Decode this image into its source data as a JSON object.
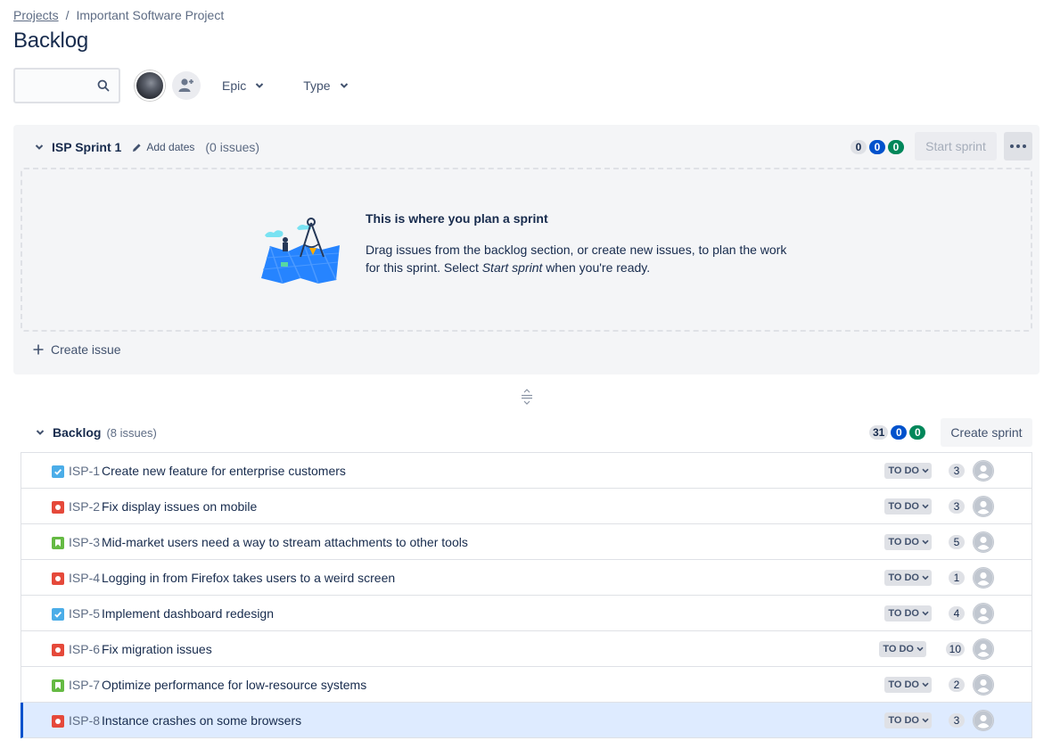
{
  "breadcrumb": {
    "projects": "Projects",
    "separator": "/",
    "project": "Important Software Project"
  },
  "page_title": "Backlog",
  "toolbar": {
    "search_placeholder": "",
    "filters": [
      {
        "label": "Epic"
      },
      {
        "label": "Type"
      }
    ]
  },
  "sprint": {
    "name": "ISP Sprint 1",
    "add_dates": "Add dates",
    "issue_count": "(0 issues)",
    "counts": {
      "todo": "0",
      "in_progress": "0",
      "done": "0"
    },
    "start_label": "Start sprint",
    "empty_title": "This is where you plan a sprint",
    "empty_desc_1": "Drag issues from the backlog section, or create new issues, to plan the work for this sprint. Select ",
    "empty_desc_em": "Start sprint",
    "empty_desc_2": " when you're ready.",
    "create_issue": "Create issue"
  },
  "backlog": {
    "title": "Backlog",
    "issue_count": "(8 issues)",
    "counts": {
      "todo": "31",
      "in_progress": "0",
      "done": "0"
    },
    "create_sprint": "Create sprint",
    "issues": [
      {
        "type": "task",
        "key": "ISP-1",
        "summary": "Create new feature for enterprise customers",
        "status": "TO DO",
        "estimate": "3"
      },
      {
        "type": "bug",
        "key": "ISP-2",
        "summary": "Fix display issues on mobile",
        "status": "TO DO",
        "estimate": "3"
      },
      {
        "type": "story",
        "key": "ISP-3",
        "summary": "Mid-market users need a way to stream attachments to other tools",
        "status": "TO DO",
        "estimate": "5"
      },
      {
        "type": "bug",
        "key": "ISP-4",
        "summary": "Logging in from Firefox takes users to a weird screen",
        "status": "TO DO",
        "estimate": "1"
      },
      {
        "type": "task",
        "key": "ISP-5",
        "summary": "Implement dashboard redesign",
        "status": "TO DO",
        "estimate": "4"
      },
      {
        "type": "bug",
        "key": "ISP-6",
        "summary": "Fix migration issues",
        "status": "TO DO",
        "estimate": "10"
      },
      {
        "type": "story",
        "key": "ISP-7",
        "summary": "Optimize performance for low-resource systems",
        "status": "TO DO",
        "estimate": "2"
      },
      {
        "type": "bug",
        "key": "ISP-8",
        "summary": "Instance crashes on some browsers",
        "status": "TO DO",
        "estimate": "3",
        "selected": true
      }
    ]
  },
  "colors": {
    "task": "#4bade8",
    "bug": "#e5493a",
    "story": "#65ba43",
    "accent": "#0052cc",
    "done": "#00875a"
  }
}
